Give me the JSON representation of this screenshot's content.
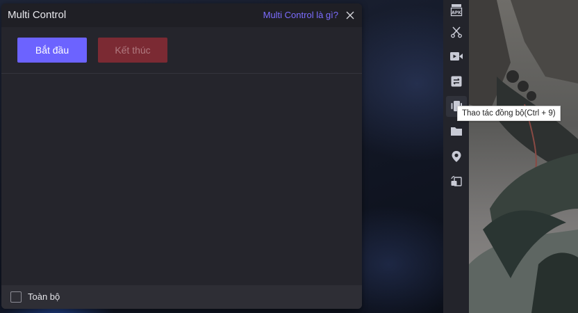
{
  "panel": {
    "title": "Multi Control",
    "help_link": "Multi Control là gì?",
    "start_label": "Bắt đầu",
    "stop_label": "Kết thúc",
    "select_all_label": "Toàn bộ",
    "select_all_checked": false
  },
  "toolbar": {
    "items": [
      {
        "icon": "apk-icon",
        "label": "APK"
      },
      {
        "icon": "scissors-icon"
      },
      {
        "icon": "video-record-icon"
      },
      {
        "icon": "operation-record-icon"
      },
      {
        "icon": "sync-operation-icon",
        "active": true
      },
      {
        "icon": "folder-icon"
      },
      {
        "icon": "location-pin-icon"
      },
      {
        "icon": "rotate-screen-icon"
      }
    ],
    "tooltip": "Thao tác đồng bộ(Ctrl + 9)"
  },
  "colors": {
    "accent": "#6c63ff",
    "stop_button": "#7b2a33",
    "panel_bg": "#25252c",
    "link": "#7c6dff"
  }
}
